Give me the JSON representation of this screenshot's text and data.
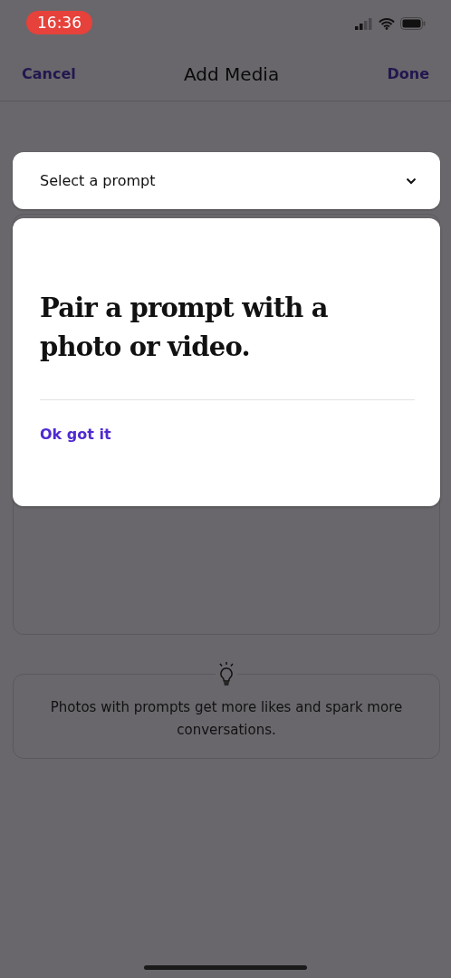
{
  "status_bar": {
    "time": "16:36"
  },
  "nav": {
    "cancel": "Cancel",
    "title": "Add Media",
    "done": "Done"
  },
  "prompt_select": {
    "placeholder": "Select a prompt"
  },
  "popup": {
    "message": "Pair a prompt with a photo or video.",
    "action": "Ok got it"
  },
  "tip": {
    "text": "Photos with prompts get more likes and spark more conversations."
  }
}
